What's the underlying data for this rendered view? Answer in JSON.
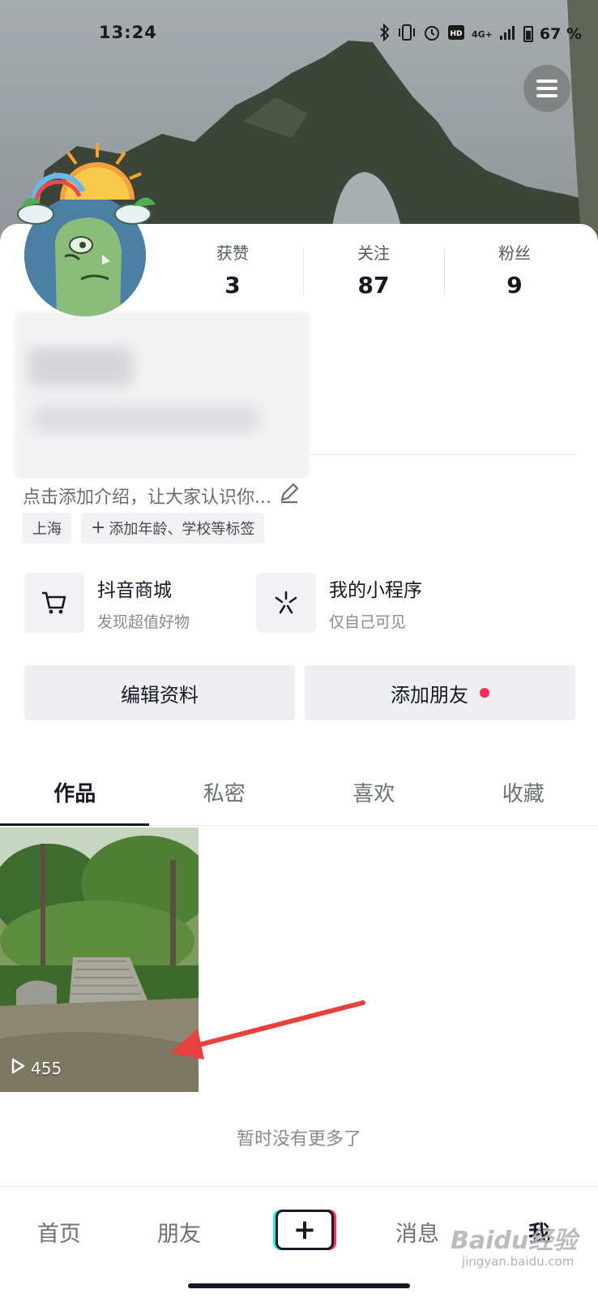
{
  "status_bar": {
    "time": "13:24",
    "network": "4G+",
    "battery_percent": "67",
    "battery_suffix": "%"
  },
  "profile": {
    "stats": [
      {
        "label": "获赞",
        "value": "3"
      },
      {
        "label": "关注",
        "value": "87"
      },
      {
        "label": "粉丝",
        "value": "9"
      }
    ],
    "bio_placeholder": "点击添加介绍，让大家认识你...",
    "tags": {
      "location": "上海",
      "add_tag": "添加年龄、学校等标签"
    }
  },
  "shortcuts": [
    {
      "title": "抖音商城",
      "subtitle": "发现超值好物",
      "icon": "cart-icon"
    },
    {
      "title": "我的小程序",
      "subtitle": "仅自己可见",
      "icon": "mini-program-icon"
    }
  ],
  "actions": {
    "edit_profile": "编辑资料",
    "add_friend": "添加朋友"
  },
  "tabs": [
    {
      "label": "作品",
      "active": true
    },
    {
      "label": "私密",
      "active": false
    },
    {
      "label": "喜欢",
      "active": false
    },
    {
      "label": "收藏",
      "active": false
    }
  ],
  "videos": [
    {
      "play_count": "455"
    }
  ],
  "no_more_text": "暂时没有更多了",
  "bottom_nav": {
    "home": "首页",
    "friends": "朋友",
    "create": "+",
    "messages": "消息",
    "me": "我"
  },
  "watermark": {
    "brand": "Baidu经验",
    "url": "jingyan.baidu.com"
  },
  "colors": {
    "accent_red": "#fe2c55",
    "accent_cyan": "#25f4ee",
    "annotation_arrow": "#e8413d"
  }
}
